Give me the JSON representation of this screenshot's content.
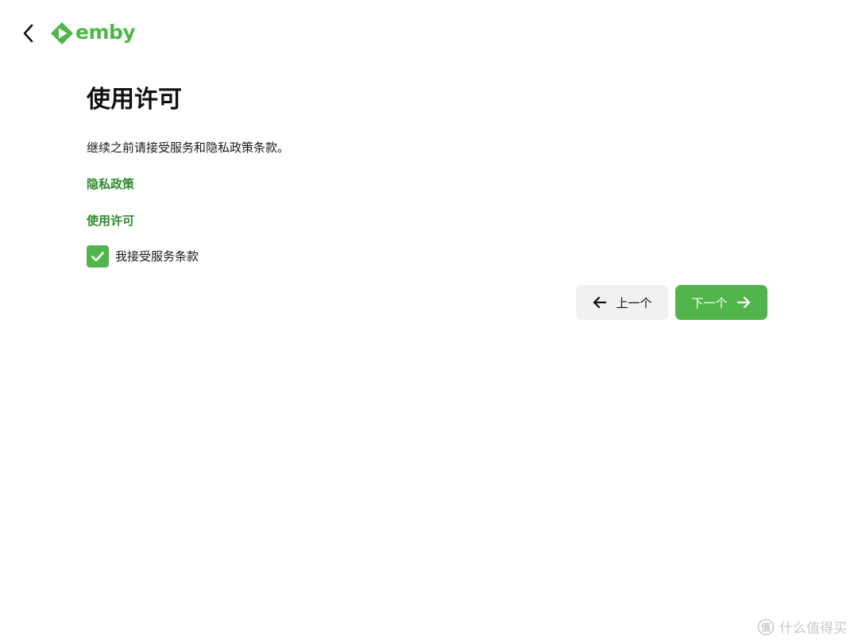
{
  "header": {
    "back_icon": "chevron-left-icon",
    "logo_text": "emby",
    "brand_color": "#52b54b"
  },
  "main": {
    "title": "使用许可",
    "description": "继续之前请接受服务和隐私政策条款。",
    "privacy_link": "隐私政策",
    "license_link": "使用许可",
    "accept_label": "我接受服务条款",
    "accept_checked": true,
    "link_color": "#2e8b2e"
  },
  "nav": {
    "prev_label": "上一个",
    "next_label": "下一个",
    "prev_icon": "arrow-left-icon",
    "next_icon": "arrow-right-icon"
  },
  "watermark": {
    "text": "什么值得买"
  }
}
